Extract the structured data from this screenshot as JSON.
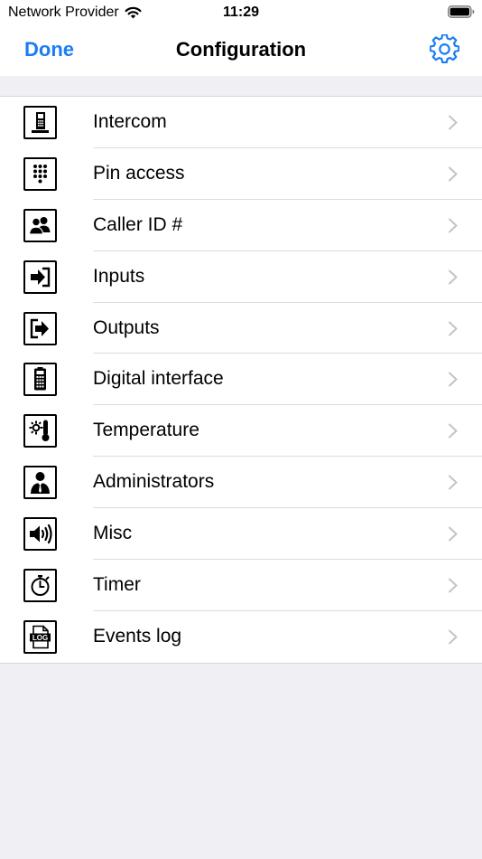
{
  "status_bar": {
    "carrier": "Network Provider",
    "time": "11:29"
  },
  "nav": {
    "done_label": "Done",
    "title": "Configuration",
    "settings_icon": "gear-icon"
  },
  "menu": {
    "items": [
      {
        "label": "Intercom",
        "icon": "intercom-icon"
      },
      {
        "label": "Pin access",
        "icon": "keypad-icon"
      },
      {
        "label": "Caller ID #",
        "icon": "users-icon"
      },
      {
        "label": "Inputs",
        "icon": "sign-in-icon"
      },
      {
        "label": "Outputs",
        "icon": "sign-out-icon"
      },
      {
        "label": "Digital interface",
        "icon": "remote-icon"
      },
      {
        "label": "Temperature",
        "icon": "thermometer-icon"
      },
      {
        "label": "Administrators",
        "icon": "admin-icon"
      },
      {
        "label": "Misc",
        "icon": "speaker-icon"
      },
      {
        "label": "Timer",
        "icon": "stopwatch-icon"
      },
      {
        "label": "Events log",
        "icon": "log-file-icon"
      }
    ]
  },
  "colors": {
    "accent": "#1a7cf3",
    "background": "#efeff4"
  }
}
